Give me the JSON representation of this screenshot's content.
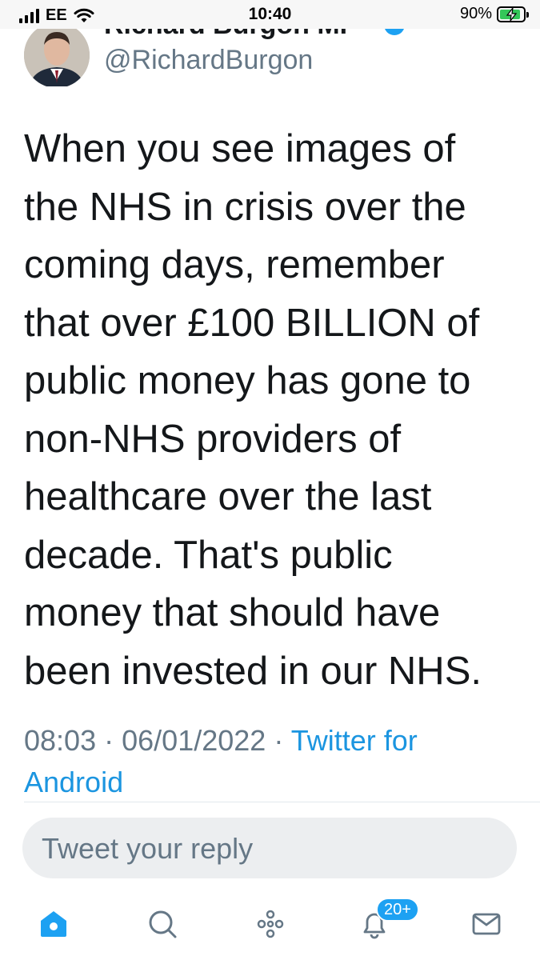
{
  "status_bar": {
    "carrier": "EE",
    "time": "10:40",
    "battery_percent": "90%",
    "battery_level": 0.9,
    "icons": [
      "signal-icon",
      "wifi-icon",
      "battery-charging-icon"
    ]
  },
  "author": {
    "display_name": "Richard Burgon MP",
    "handle": "@RichardBurgon",
    "verified": true
  },
  "tweet": {
    "text": "When you see images of\nthe NHS in crisis over the\ncoming days, remember\nthat over £100 BILLION of\npublic money has gone to\nnon-NHS providers of\nhealthcare over the last\ndecade. That's public\nmoney that should have\nbeen invested in our NHS.",
    "time": "08:03",
    "separator": "·",
    "date": "06/01/2022",
    "source": "Twitter for Android"
  },
  "reply": {
    "placeholder": "Tweet your reply"
  },
  "tab_bar": {
    "tabs": [
      "home-icon",
      "search-icon",
      "spaces-icon",
      "notifications-icon",
      "messages-icon"
    ],
    "notifications_badge": "20+"
  },
  "colors": {
    "accent": "#1da1f2",
    "link": "#1b95e0",
    "text": "#14171a",
    "secondary_text": "#657786",
    "reply_box": "#eceef0"
  }
}
